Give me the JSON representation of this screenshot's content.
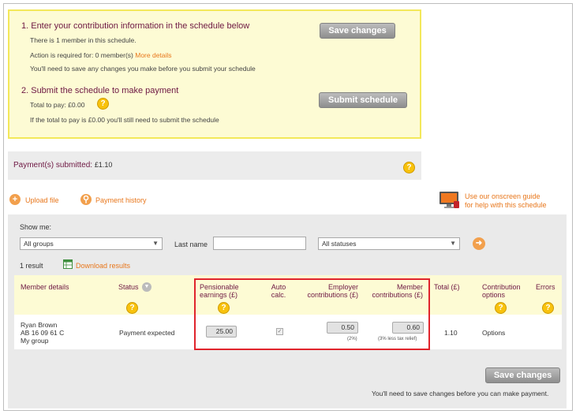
{
  "step1": {
    "title": "1. Enter your contribution information in the schedule below",
    "members": "There is 1 member in this schedule.",
    "action_required": "Action is required for: 0 member(s)",
    "more_details": "More details",
    "save_note": "You'll need to save any changes you make before you submit your schedule",
    "save_button": "Save changes"
  },
  "step2": {
    "title": "2. Submit the schedule to make payment",
    "total_to_pay": "Total to pay: £0.00",
    "note": "If the total to pay is £0.00 you'll still need to submit the schedule",
    "submit_button": "Submit schedule"
  },
  "payments": {
    "label": "Payment(s) submitted:",
    "amount": "£1.10"
  },
  "actions": {
    "upload": "Upload file",
    "history": "Payment history",
    "guide_line1": "Use our onscreen guide",
    "guide_line2": "for help with this schedule"
  },
  "filter": {
    "show_me": "Show me:",
    "groups_value": "All groups",
    "last_name_label": "Last name",
    "last_name_value": "",
    "status_value": "All statuses"
  },
  "results": {
    "count": "1 result",
    "download": "Download results"
  },
  "table": {
    "headers": {
      "member_details": "Member details",
      "status": "Status",
      "pensionable_1": "Pensionable",
      "pensionable_2": "earnings (£)",
      "auto_1": "Auto",
      "auto_2": "calc.",
      "employer_1": "Employer",
      "employer_2": "contributions (£)",
      "member_1": "Member",
      "member_2": "contributions (£)",
      "total": "Total (£)",
      "options_1": "Contribution",
      "options_2": "options",
      "errors": "Errors"
    },
    "row": {
      "name": "Ryan Brown",
      "ni": "AB 16 09 61 C",
      "group": "My group",
      "status": "Payment expected",
      "earnings": "25.00",
      "employer": "0.50",
      "employer_note": "(2%)",
      "member": "0.60",
      "member_note": "(3% less tax relief)",
      "total": "1.10",
      "options": "Options"
    }
  },
  "footer": {
    "save_button": "Save changes",
    "note": "You'll need to save changes before you can make payment."
  },
  "colors": {
    "accent": "#e8771c",
    "heading": "#6d1742",
    "highlight": "#e0242c",
    "panel": "#fdfbd4"
  }
}
